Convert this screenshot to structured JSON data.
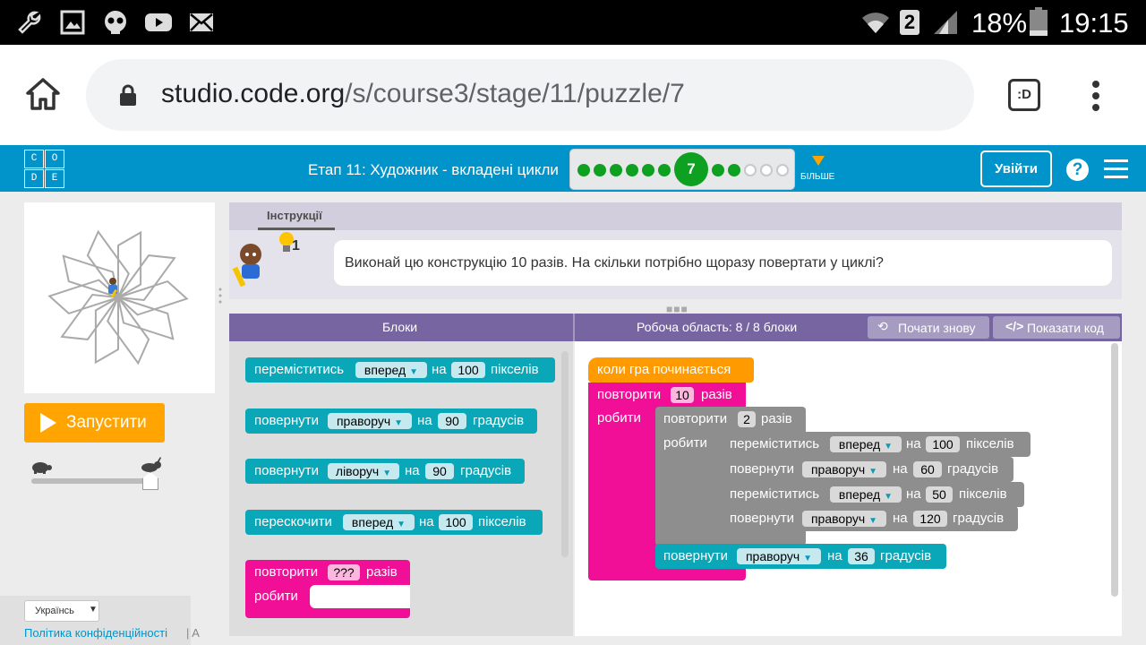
{
  "status_bar": {
    "icons": [
      "wrench-icon",
      "image-icon",
      "skull-icon",
      "youtube-icon",
      "mail-icon",
      "wifi-icon",
      "sim-2-icon",
      "signal-icon",
      "battery-icon"
    ],
    "sim_label": "2",
    "battery": "18%",
    "time": "19:15"
  },
  "browser": {
    "url_host": "studio.code.org",
    "url_path": "/s/course3/stage/11/puzzle/7",
    "tab_badge": ":D"
  },
  "header": {
    "logo": [
      "C",
      "O",
      "D",
      "E"
    ],
    "stage_title": "Етап 11: Художник - вкладені цикли",
    "progress": {
      "current": "7",
      "completed_before": 6,
      "completed_after": 2,
      "remaining": 3
    },
    "more_label": "БІЛЬШЕ",
    "signin_label": "Увійти",
    "help_label": "?"
  },
  "left_panel": {
    "run_label": "Запустити",
    "speed_level": 1.0,
    "language": "Українсь",
    "privacy_link": "Політика конфіденційності",
    "footer_separator": "|  A"
  },
  "instructions": {
    "tab_label": "Інструкції",
    "hint_count": "1",
    "text": "Виконай цю конструкцію 10 разів. На скільки потрібно щоразу повертати у циклі?"
  },
  "workspace_header": {
    "toolbox_label": "Блоки",
    "workspace_label": "Робоча область: 8 / 8 блоки",
    "reset_label": "Почати знову",
    "show_code_label": "Показати код",
    "grip": "■■■"
  },
  "toolbox": {
    "move_forward": {
      "verb": "переміститись",
      "dir": "вперед",
      "on": "на",
      "value": "100",
      "unit": "пікселів"
    },
    "turn_right": {
      "verb": "повернути",
      "dir": "праворуч",
      "on": "на",
      "value": "90",
      "unit": "градусів"
    },
    "turn_left": {
      "verb": "повернути",
      "dir": "ліворуч",
      "on": "на",
      "value": "90",
      "unit": "градусів"
    },
    "jump_forward": {
      "verb": "перескочити",
      "dir": "вперед",
      "on": "на",
      "value": "100",
      "unit": "пікселів"
    },
    "repeat": {
      "verb": "повторити",
      "value": "???",
      "unit": "разів",
      "do": "робити"
    }
  },
  "workspace": {
    "when_run": "коли гра починається",
    "outer_repeat": {
      "verb": "повторити",
      "value": "10",
      "unit": "разів",
      "do": "робити"
    },
    "inner_repeat": {
      "verb": "повторити",
      "value": "2",
      "unit": "разів",
      "do": "робити"
    },
    "inner_blocks": [
      {
        "verb": "переміститись",
        "dir": "вперед",
        "on": "на",
        "value": "100",
        "unit": "пікселів"
      },
      {
        "verb": "повернути",
        "dir": "праворуч",
        "on": "на",
        "value": "60",
        "unit": "градусів"
      },
      {
        "verb": "переміститись",
        "dir": "вперед",
        "on": "на",
        "value": "50",
        "unit": "пікселів"
      },
      {
        "verb": "повернути",
        "dir": "праворуч",
        "on": "на",
        "value": "120",
        "unit": "градусів"
      }
    ],
    "outer_turn": {
      "verb": "повернути",
      "dir": "праворуч",
      "on": "на",
      "value": "36",
      "unit": "градусів"
    }
  },
  "colors": {
    "header_bg": "#0094ca",
    "purple": "#7665a0",
    "teal_block": "#0aa7b8",
    "pink_block": "#f20f98",
    "grey_block": "#8e8e8e",
    "orange": "#ff9a00",
    "progress_green": "#0ea020"
  }
}
